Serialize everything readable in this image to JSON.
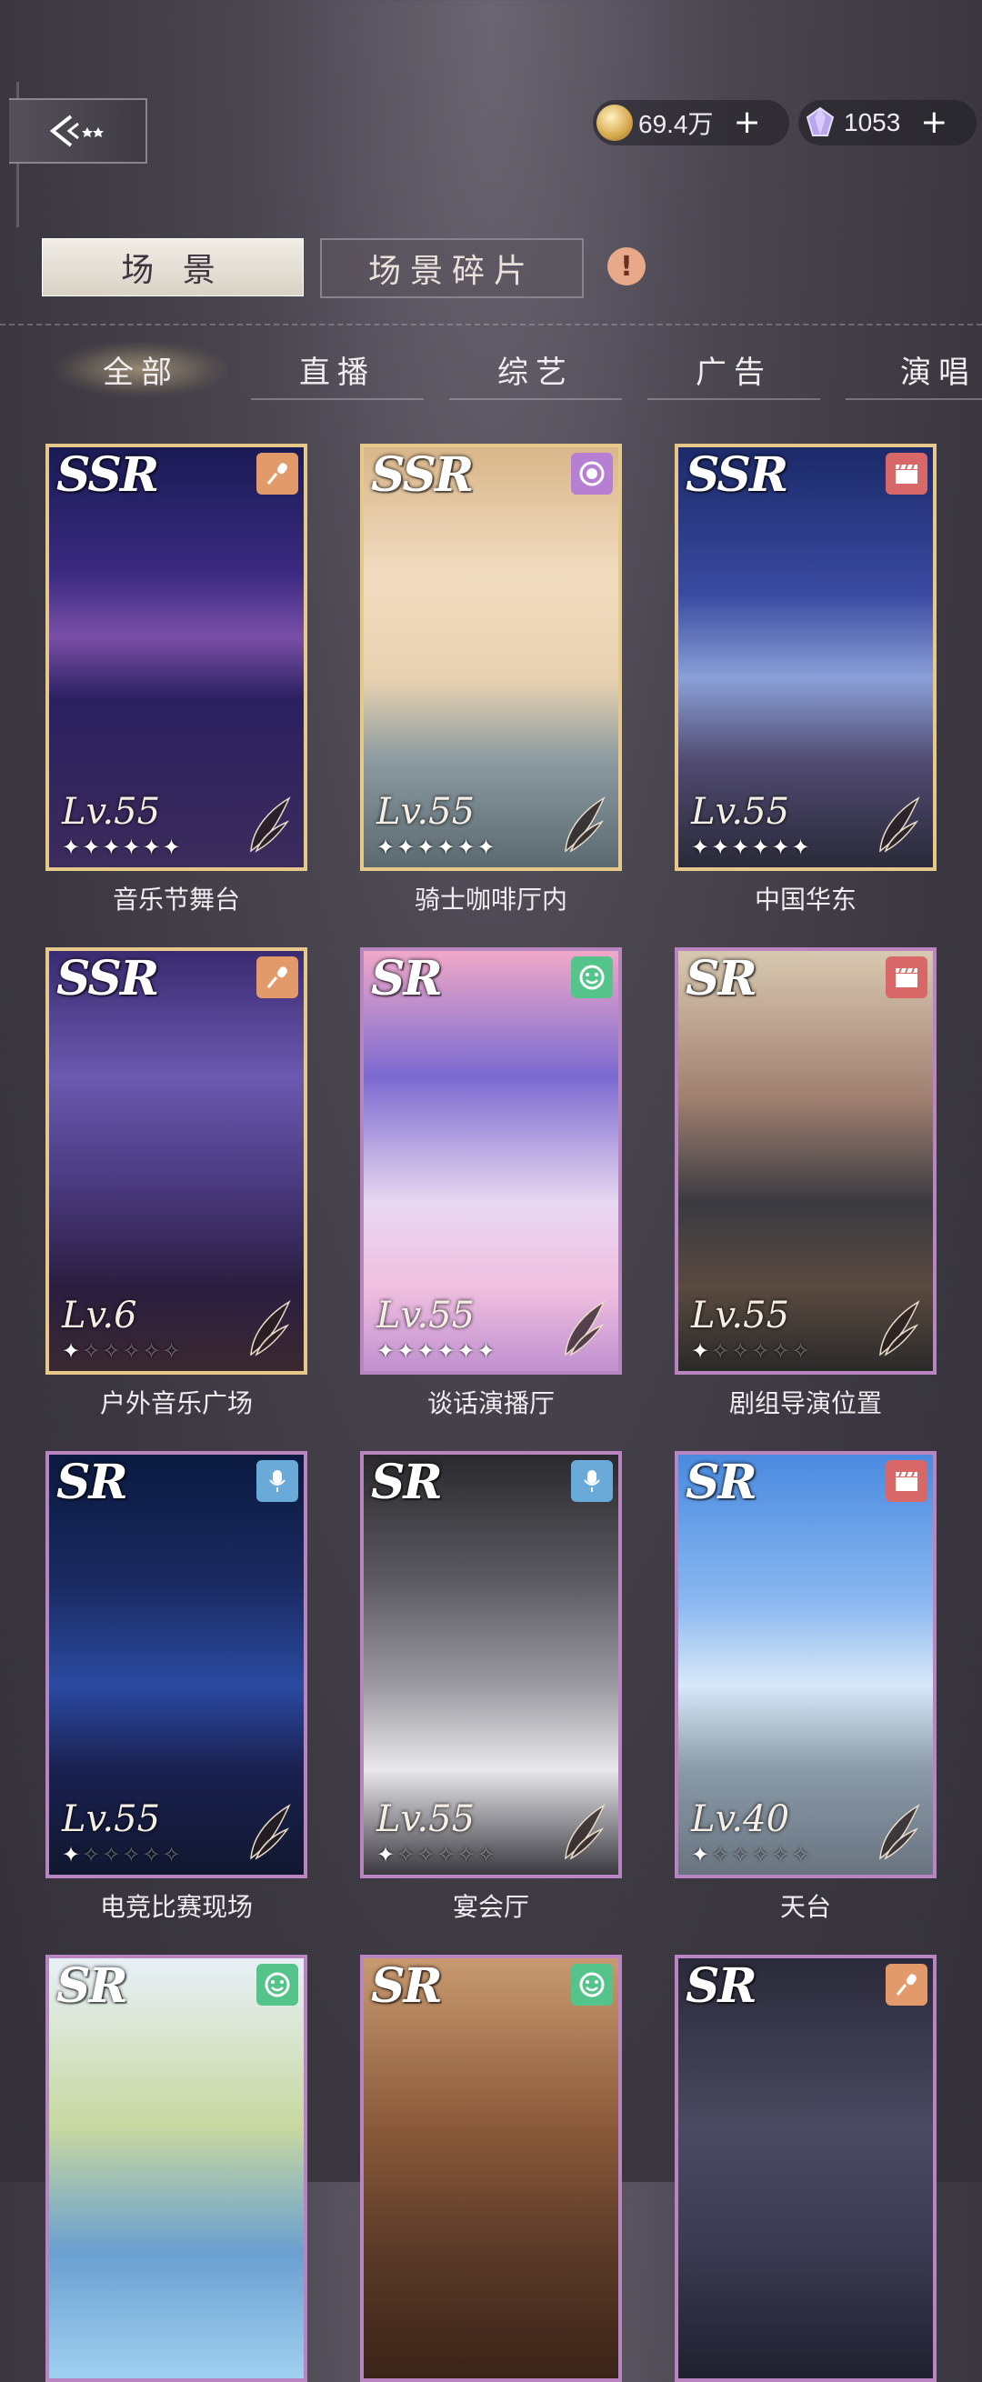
{
  "header": {
    "currencies": [
      {
        "name": "coin",
        "value": "69.4万",
        "plus": "+"
      },
      {
        "name": "gem",
        "value": "1053",
        "plus": "+"
      }
    ]
  },
  "main_tabs": [
    {
      "label": "场 景",
      "active": true
    },
    {
      "label": "场景碎片",
      "active": false
    }
  ],
  "warning_icon": "!",
  "categories": [
    {
      "label": "全部",
      "active": true
    },
    {
      "label": "直播",
      "active": false
    },
    {
      "label": "综艺",
      "active": false
    },
    {
      "label": "广告",
      "active": false
    },
    {
      "label": "演唱",
      "active": false
    }
  ],
  "cards": [
    {
      "rarity": "SSR",
      "type_icon": "microphone-icon",
      "type_color": "#e29a6a",
      "level": "Lv.55",
      "stars_on": 6,
      "stars_total": 6,
      "name": "音乐节舞台"
    },
    {
      "rarity": "SSR",
      "type_icon": "camera-lens-icon",
      "type_color": "#b77fd4",
      "level": "Lv.55",
      "stars_on": 6,
      "stars_total": 6,
      "name": "骑士咖啡厅内"
    },
    {
      "rarity": "SSR",
      "type_icon": "clapperboard-icon",
      "type_color": "#d86868",
      "level": "Lv.55",
      "stars_on": 6,
      "stars_total": 6,
      "name": "中国华东"
    },
    {
      "rarity": "SSR",
      "type_icon": "microphone-icon",
      "type_color": "#e29a6a",
      "level": "Lv.6",
      "stars_on": 1,
      "stars_total": 6,
      "name": "户外音乐广场"
    },
    {
      "rarity": "SR",
      "type_icon": "smiley-icon",
      "type_color": "#55c48a",
      "level": "Lv.55",
      "stars_on": 6,
      "stars_total": 6,
      "name": "谈话演播厅"
    },
    {
      "rarity": "SR",
      "type_icon": "clapperboard-icon",
      "type_color": "#d86868",
      "level": "Lv.55",
      "stars_on": 1,
      "stars_total": 6,
      "name": "剧组导演位置"
    },
    {
      "rarity": "SR",
      "type_icon": "podcast-mic-icon",
      "type_color": "#6aaad8",
      "level": "Lv.55",
      "stars_on": 1,
      "stars_total": 6,
      "name": "电竞比赛现场"
    },
    {
      "rarity": "SR",
      "type_icon": "podcast-mic-icon",
      "type_color": "#6aaad8",
      "level": "Lv.55",
      "stars_on": 1,
      "stars_total": 6,
      "name": "宴会厅"
    },
    {
      "rarity": "SR",
      "type_icon": "clapperboard-icon",
      "type_color": "#d86868",
      "level": "Lv.40",
      "stars_on": 1,
      "stars_total": 6,
      "name": "天台"
    },
    {
      "rarity": "SR",
      "type_icon": "smiley-icon",
      "type_color": "#55c48a",
      "level": "",
      "stars_on": 0,
      "stars_total": 0,
      "name": ""
    },
    {
      "rarity": "SR",
      "type_icon": "smiley-icon",
      "type_color": "#55c48a",
      "level": "",
      "stars_on": 0,
      "stars_total": 0,
      "name": ""
    },
    {
      "rarity": "SR",
      "type_icon": "microphone-icon",
      "type_color": "#e29a6a",
      "level": "",
      "stars_on": 0,
      "stars_total": 0,
      "name": ""
    }
  ],
  "colors": {
    "ssr_frame": "#e6c98a",
    "sr_frame": "#b985c0"
  }
}
